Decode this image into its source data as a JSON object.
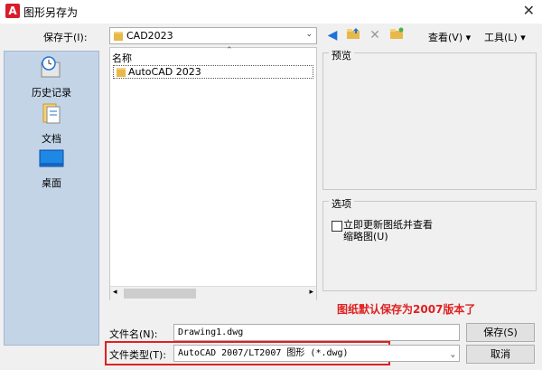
{
  "window": {
    "app_icon_letter": "A",
    "title": "图形另存为",
    "close_glyph": "✕"
  },
  "toolbar": {
    "save_in_label": "保存于(I):",
    "save_in_value": "CAD2023",
    "view_label": "查看(V)",
    "tools_label": "工具(L)"
  },
  "sidebar": {
    "items": [
      {
        "label": "历史记录",
        "icon": "history-icon"
      },
      {
        "label": "文档",
        "icon": "documents-icon"
      },
      {
        "label": "桌面",
        "icon": "desktop-icon"
      }
    ]
  },
  "filelist": {
    "column_name": "名称",
    "items": [
      {
        "name": "AutoCAD 2023",
        "type": "folder"
      }
    ]
  },
  "preview": {
    "label": "预览"
  },
  "options": {
    "label": "选项",
    "checkbox_label_line1": "立即更新图纸并查看",
    "checkbox_label_line2": "缩略图(U)",
    "checked": false
  },
  "annotation": {
    "text": "图纸默认保存为2007版本了",
    "color": "#e02020"
  },
  "filename": {
    "label": "文件名(N):",
    "value": "Drawing1.dwg"
  },
  "filetype": {
    "label": "文件类型(T):",
    "value": "AutoCAD 2007/LT2007 图形 (*.dwg)"
  },
  "buttons": {
    "save": "保存(S)",
    "cancel": "取消"
  },
  "colors": {
    "sidebar_bg": "#c3d4e7",
    "highlight": "#e02020",
    "app_icon": "#d71d2b"
  }
}
